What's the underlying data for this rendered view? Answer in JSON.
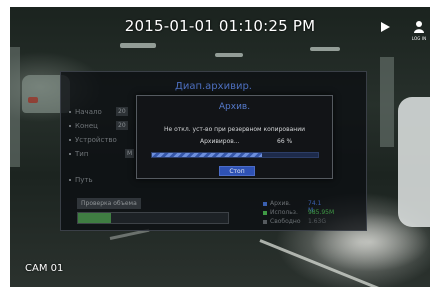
{
  "overlay": {
    "timestamp": "2015-01-01 01:10:25 PM",
    "login_label": "LOG IN",
    "camera_label": "CAM 01"
  },
  "backup_panel": {
    "title": "Диап.архивир.",
    "fields": [
      {
        "label": "Начало",
        "value": "20"
      },
      {
        "label": "Конец",
        "value": "20"
      },
      {
        "label": "Устройство",
        "value": ""
      },
      {
        "label": "Тип",
        "value": "М"
      },
      {
        "label": "Путь",
        "value": ""
      }
    ],
    "check_size_button": "Проверка объема",
    "size_bar_fraction": 0.22,
    "legend": [
      {
        "label": "Архив.",
        "value": "74.1 M",
        "color": "#3a5fb0"
      },
      {
        "label": "Использ.",
        "value": "985.95M",
        "color": "#3f9a45"
      },
      {
        "label": "Свободно",
        "value": "1.63G",
        "color": "#555a5e"
      }
    ]
  },
  "modal": {
    "title": "Архив.",
    "message": "Не откл. уст-во при резервном копировании",
    "progress_label": "Архивиров...",
    "progress_value": "66 %",
    "progress_fraction": 0.66,
    "stop_button": "Стоп"
  },
  "icons": {
    "play": "play-icon",
    "login": "user-icon"
  },
  "colors": {
    "accent": "#5579c9",
    "stop_button": "#2f52b4"
  }
}
